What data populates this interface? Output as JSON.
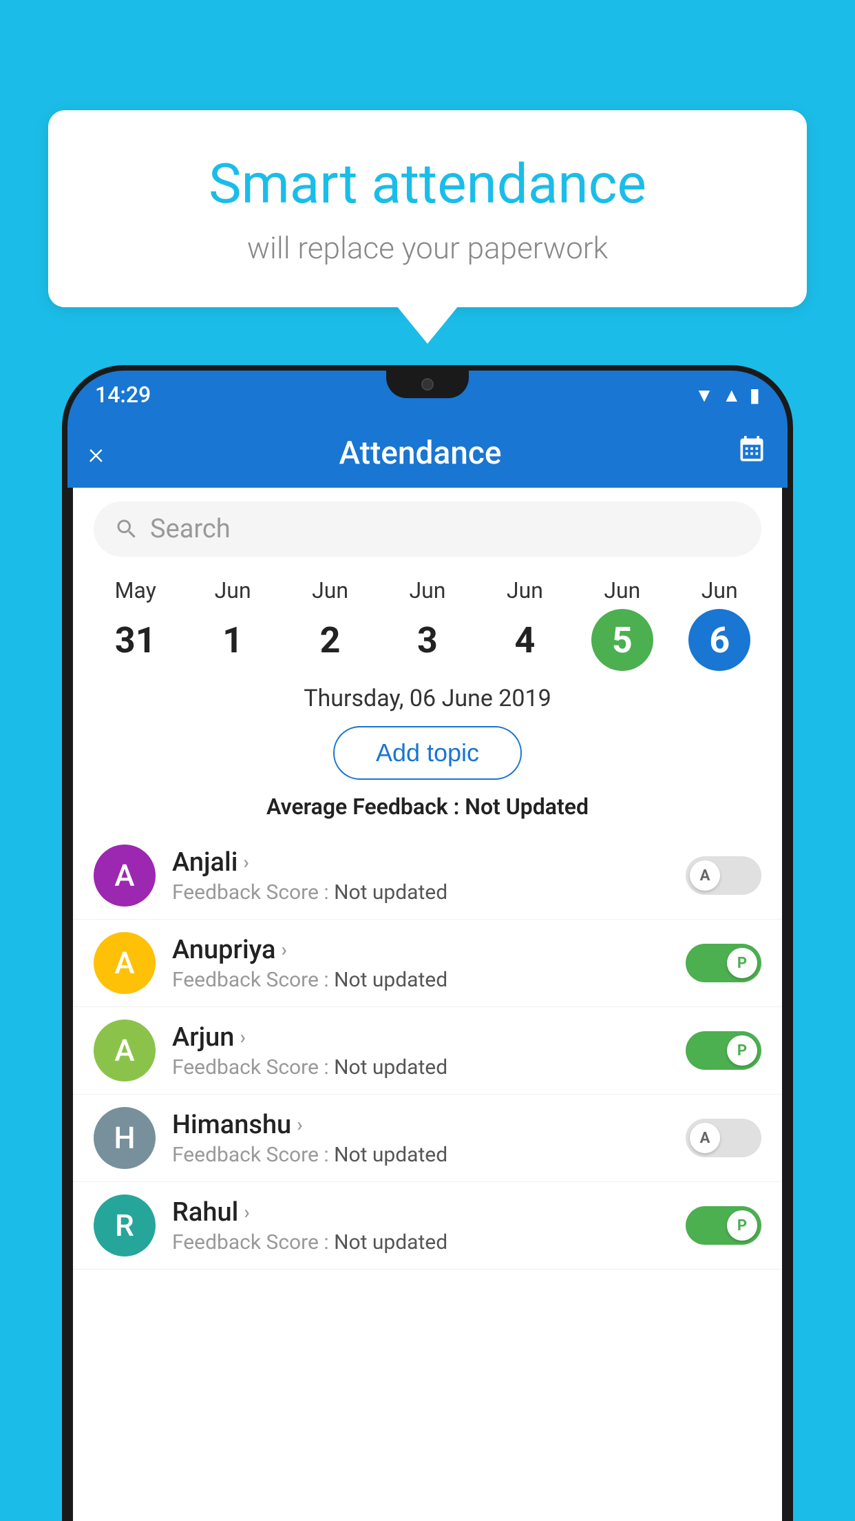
{
  "background": {
    "color": "#1BBDE8"
  },
  "speech_bubble": {
    "title": "Smart attendance",
    "subtitle": "will replace your paperwork"
  },
  "status_bar": {
    "time": "14:29",
    "icons": [
      "wifi",
      "signal",
      "battery"
    ]
  },
  "app_bar": {
    "title": "Attendance",
    "close_label": "×",
    "calendar_icon": "📅"
  },
  "search": {
    "placeholder": "Search"
  },
  "calendar": {
    "days": [
      {
        "month": "May",
        "date": "31",
        "state": "normal"
      },
      {
        "month": "Jun",
        "date": "1",
        "state": "normal"
      },
      {
        "month": "Jun",
        "date": "2",
        "state": "normal"
      },
      {
        "month": "Jun",
        "date": "3",
        "state": "normal"
      },
      {
        "month": "Jun",
        "date": "4",
        "state": "normal"
      },
      {
        "month": "Jun",
        "date": "5",
        "state": "today"
      },
      {
        "month": "Jun",
        "date": "6",
        "state": "selected"
      }
    ],
    "selected_label": "Thursday, 06 June 2019"
  },
  "add_topic_btn": "Add topic",
  "feedback_average_label": "Average Feedback :",
  "feedback_average_value": "Not Updated",
  "students": [
    {
      "name": "Anjali",
      "feedback_label": "Feedback Score :",
      "feedback_value": "Not updated",
      "avatar_letter": "A",
      "avatar_color": "#9C27B0",
      "status": "absent"
    },
    {
      "name": "Anupriya",
      "feedback_label": "Feedback Score :",
      "feedback_value": "Not updated",
      "avatar_letter": "A",
      "avatar_color": "#FFC107",
      "status": "present"
    },
    {
      "name": "Arjun",
      "feedback_label": "Feedback Score :",
      "feedback_value": "Not updated",
      "avatar_letter": "A",
      "avatar_color": "#8BC34A",
      "status": "present"
    },
    {
      "name": "Himanshu",
      "feedback_label": "Feedback Score :",
      "feedback_value": "Not updated",
      "avatar_letter": "H",
      "avatar_color": "#78909C",
      "status": "absent"
    },
    {
      "name": "Rahul",
      "feedback_label": "Feedback Score :",
      "feedback_value": "Not updated",
      "avatar_letter": "R",
      "avatar_color": "#26A69A",
      "status": "present"
    }
  ]
}
